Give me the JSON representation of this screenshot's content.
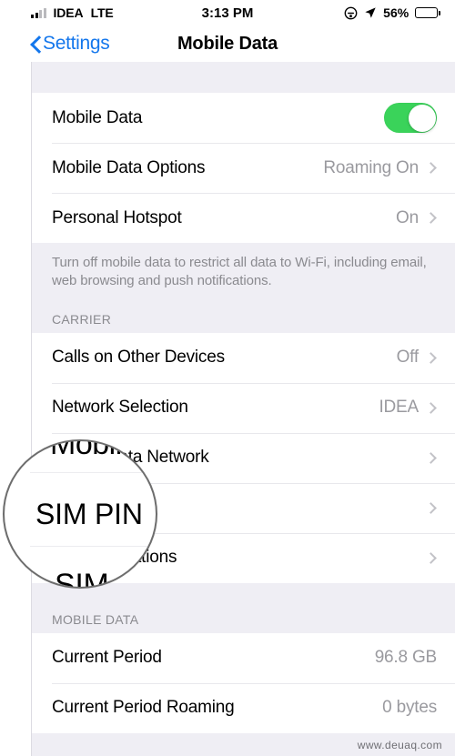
{
  "status_bar": {
    "carrier": "IDEA",
    "network_type": "LTE",
    "time": "3:13 PM",
    "battery_percent": "56%",
    "battery_level": 56,
    "battery_color": "#f6c61c",
    "signal_bars_filled": 2,
    "signal_bars_total": 4,
    "icons": [
      "signal-bars-icon",
      "do-not-disturb-icon",
      "location-arrow-icon",
      "battery-icon"
    ]
  },
  "nav_bar": {
    "back_label": "Settings",
    "title": "Mobile Data",
    "accent_color": "#1477ec"
  },
  "sections": [
    {
      "header": "",
      "footnote": "Turn off mobile data to restrict all data to Wi-Fi, including email, web browsing and push notifications.",
      "rows": [
        {
          "label": "Mobile Data",
          "value": "",
          "control": "toggle",
          "toggle_on": true
        },
        {
          "label": "Mobile Data Options",
          "value": "Roaming On",
          "control": "chevron"
        },
        {
          "label": "Personal Hotspot",
          "value": "On",
          "control": "chevron"
        }
      ]
    },
    {
      "header": "CARRIER",
      "footnote": "",
      "rows": [
        {
          "label": "Calls on Other Devices",
          "value": "Off",
          "control": "chevron"
        },
        {
          "label": "Network Selection",
          "value": "IDEA",
          "control": "chevron"
        },
        {
          "label": "Mobile Data Network",
          "value": "",
          "control": "chevron"
        },
        {
          "label": "SIM PIN",
          "value": "",
          "control": "chevron"
        },
        {
          "label": "SIM Applications",
          "value": "",
          "control": "chevron"
        }
      ]
    },
    {
      "header": "MOBILE DATA",
      "footnote": "",
      "rows": [
        {
          "label": "Current Period",
          "value": "96.8 GB",
          "control": "none"
        },
        {
          "label": "Current Period Roaming",
          "value": "0 bytes",
          "control": "none"
        }
      ]
    }
  ],
  "magnifier": {
    "top_text": "Mobile",
    "main_text": "SIM PIN",
    "bottom_text": "SIM Applications",
    "border_color": "#6d6d6d"
  },
  "watermark": "www.deuaq.com",
  "colors": {
    "group_background": "#efeef4",
    "row_background": "#ffffff",
    "toggle_on": "#3ad35a",
    "secondary_text": "#8a8a8f",
    "value_text": "#9a9a9f"
  }
}
